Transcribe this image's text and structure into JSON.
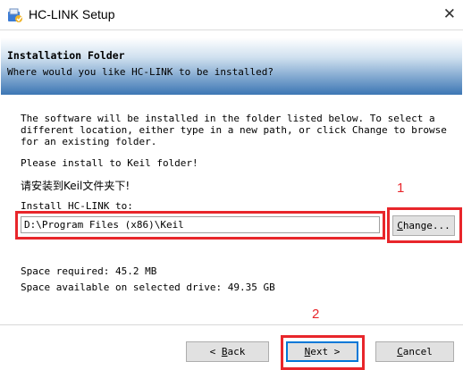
{
  "window": {
    "title": "HC-LINK Setup",
    "close_glyph": "✕"
  },
  "banner": {
    "title": "Installation Folder",
    "subtitle": "Where would you like HC-LINK to be installed?"
  },
  "body": {
    "description": "The software will be installed in the folder listed below. To select a different location, either type in a new path, or click Change to browse for an existing folder.",
    "note_en": "Please install to Keil folder!",
    "note_cn": "请安装到Keil文件夹下!",
    "install_label": "Install HC-LINK to:",
    "install_path": "D:\\Program Files (x86)\\Keil",
    "space_required": "Space required: 45.2 MB",
    "space_available": "Space available on selected drive: 49.35 GB"
  },
  "buttons": {
    "change_hotkey": "C",
    "change_rest": "hange...",
    "back_prefix": "< ",
    "back_hotkey": "B",
    "back_rest": "ack",
    "next_hotkey": "N",
    "next_rest": "ext >",
    "cancel_hotkey": "C",
    "cancel_rest": "ancel"
  },
  "annotations": {
    "label_1": "1",
    "label_2": "2"
  },
  "colors": {
    "annotation_red": "#e8262b",
    "banner_blue": "#3c76b4",
    "focus_blue": "#0078d7"
  },
  "icons": {
    "app": "installer-icon",
    "close": "close-icon"
  }
}
